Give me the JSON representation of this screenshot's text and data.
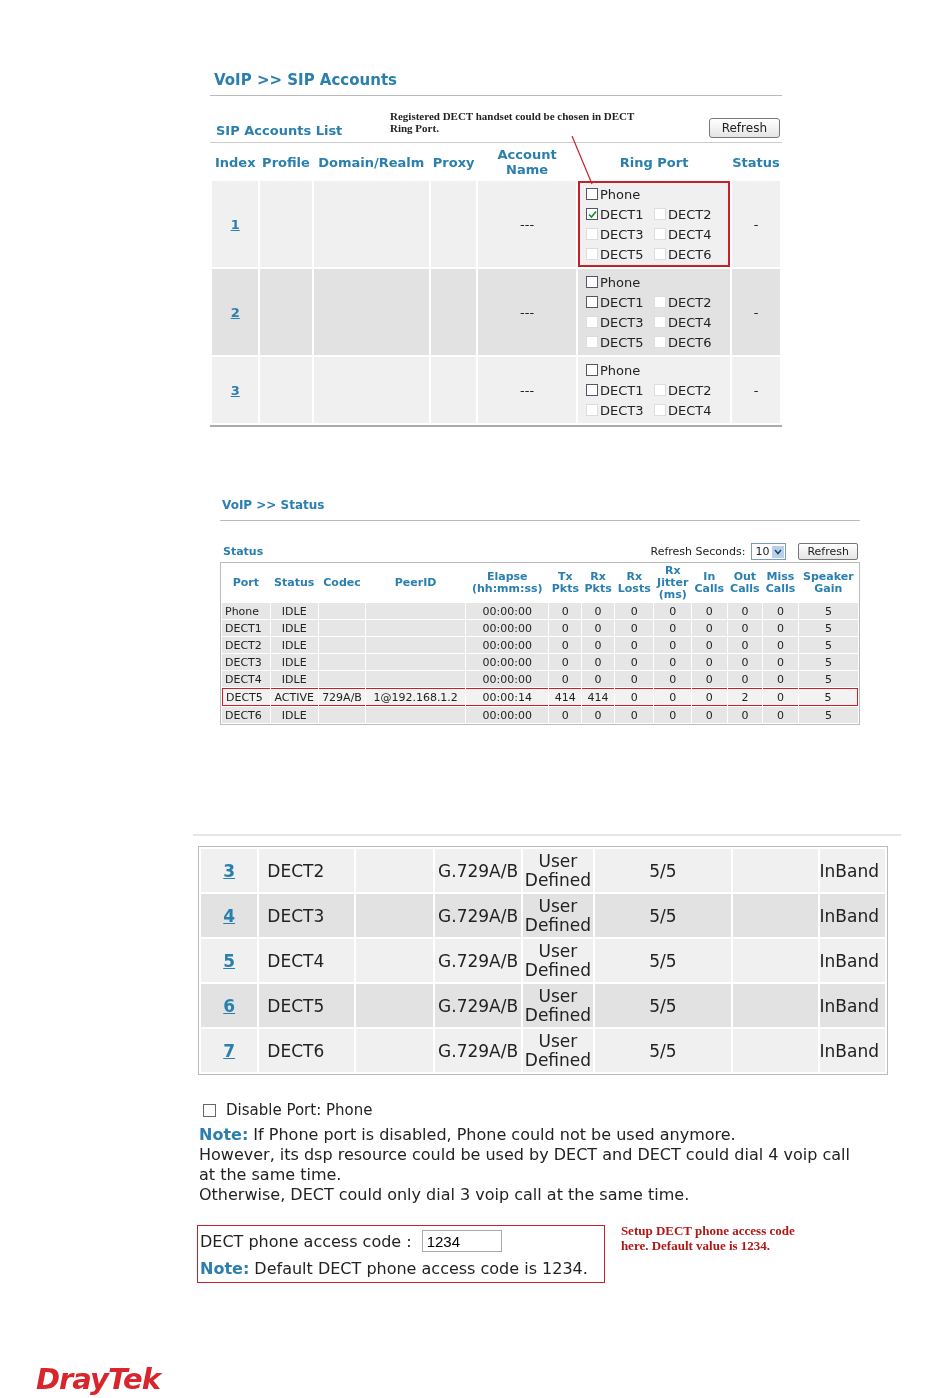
{
  "sip_accounts": {
    "title": "VoIP >> SIP Accounts",
    "list_title": "SIP Accounts List",
    "callout": "Registered DECT handset could be chosen in DECT Ring Port.",
    "refresh_button": "Refresh",
    "columns": [
      "Index",
      "Profile",
      "Domain/Realm",
      "Proxy",
      "Account\nName",
      "Ring Port",
      "Status"
    ],
    "rows": [
      {
        "index": "1",
        "account_name": "---",
        "status": "-",
        "highlighted": true,
        "ring_ports": [
          {
            "label": "Phone",
            "checked": false,
            "disabled": false
          },
          {
            "label": "DECT1",
            "checked": true,
            "disabled": false
          },
          {
            "label": "DECT2",
            "checked": false,
            "disabled": true
          },
          {
            "label": "DECT3",
            "checked": false,
            "disabled": true
          },
          {
            "label": "DECT4",
            "checked": false,
            "disabled": true
          },
          {
            "label": "DECT5",
            "checked": false,
            "disabled": true
          },
          {
            "label": "DECT6",
            "checked": false,
            "disabled": true
          }
        ]
      },
      {
        "index": "2",
        "account_name": "---",
        "status": "-",
        "highlighted": false,
        "ring_ports": [
          {
            "label": "Phone",
            "checked": false,
            "disabled": false
          },
          {
            "label": "DECT1",
            "checked": false,
            "disabled": false
          },
          {
            "label": "DECT2",
            "checked": false,
            "disabled": true
          },
          {
            "label": "DECT3",
            "checked": false,
            "disabled": true
          },
          {
            "label": "DECT4",
            "checked": false,
            "disabled": true
          },
          {
            "label": "DECT5",
            "checked": false,
            "disabled": true
          },
          {
            "label": "DECT6",
            "checked": false,
            "disabled": true
          }
        ]
      },
      {
        "index": "3",
        "account_name": "---",
        "status": "-",
        "highlighted": false,
        "ring_ports": [
          {
            "label": "Phone",
            "checked": false,
            "disabled": false
          },
          {
            "label": "DECT1",
            "checked": false,
            "disabled": false
          },
          {
            "label": "DECT2",
            "checked": false,
            "disabled": true
          },
          {
            "label": "DECT3",
            "checked": false,
            "disabled": true
          },
          {
            "label": "DECT4",
            "checked": false,
            "disabled": true
          }
        ]
      }
    ]
  },
  "voip_status": {
    "title": "VoIP >> Status",
    "section_title": "Status",
    "refresh_label": "Refresh Seconds:",
    "refresh_seconds": "10",
    "refresh_button": "Refresh",
    "columns": [
      "Port",
      "Status",
      "Codec",
      "PeerID",
      "Elapse\n(hh:mm:ss)",
      "Tx\nPkts",
      "Rx\nPkts",
      "Rx\nLosts",
      "Rx\nJitter\n(ms)",
      "In\nCalls",
      "Out\nCalls",
      "Miss\nCalls",
      "Speaker\nGain"
    ],
    "rows": [
      {
        "highlighted": false,
        "cells": [
          "Phone",
          "IDLE",
          "",
          "",
          "00:00:00",
          "0",
          "0",
          "0",
          "0",
          "0",
          "0",
          "0",
          "5"
        ]
      },
      {
        "highlighted": false,
        "cells": [
          "DECT1",
          "IDLE",
          "",
          "",
          "00:00:00",
          "0",
          "0",
          "0",
          "0",
          "0",
          "0",
          "0",
          "5"
        ]
      },
      {
        "highlighted": false,
        "cells": [
          "DECT2",
          "IDLE",
          "",
          "",
          "00:00:00",
          "0",
          "0",
          "0",
          "0",
          "0",
          "0",
          "0",
          "5"
        ]
      },
      {
        "highlighted": false,
        "cells": [
          "DECT3",
          "IDLE",
          "",
          "",
          "00:00:00",
          "0",
          "0",
          "0",
          "0",
          "0",
          "0",
          "0",
          "5"
        ]
      },
      {
        "highlighted": false,
        "cells": [
          "DECT4",
          "IDLE",
          "",
          "",
          "00:00:00",
          "0",
          "0",
          "0",
          "0",
          "0",
          "0",
          "0",
          "5"
        ]
      },
      {
        "highlighted": true,
        "cells": [
          "DECT5",
          "ACTIVE",
          "729A/B",
          "1@192.168.1.2",
          "00:00:14",
          "414",
          "414",
          "0",
          "0",
          "0",
          "2",
          "0",
          "5"
        ]
      },
      {
        "highlighted": false,
        "cells": [
          "DECT6",
          "IDLE",
          "",
          "",
          "00:00:00",
          "0",
          "0",
          "0",
          "0",
          "0",
          "0",
          "0",
          "5"
        ]
      }
    ]
  },
  "port_settings": {
    "rows": [
      {
        "index": "3",
        "port": "DECT2",
        "codec": "G.729A/B",
        "tone": "User Defined",
        "gain": "5/5",
        "dtmf": "InBand"
      },
      {
        "index": "4",
        "port": "DECT3",
        "codec": "G.729A/B",
        "tone": "User Defined",
        "gain": "5/5",
        "dtmf": "InBand"
      },
      {
        "index": "5",
        "port": "DECT4",
        "codec": "G.729A/B",
        "tone": "User Defined",
        "gain": "5/5",
        "dtmf": "InBand"
      },
      {
        "index": "6",
        "port": "DECT5",
        "codec": "G.729A/B",
        "tone": "User Defined",
        "gain": "5/5",
        "dtmf": "InBand"
      },
      {
        "index": "7",
        "port": "DECT6",
        "codec": "G.729A/B",
        "tone": "User Defined",
        "gain": "5/5",
        "dtmf": "InBand"
      }
    ],
    "disable_port": {
      "label": "Disable Port: Phone",
      "checked": false
    },
    "notes": [
      "**Note:** If Phone port is disabled, Phone could not be used anymore.",
      "However, its dsp resource could be used by DECT and DECT could dial 4 voip call at the same time.",
      "Otherwise, DECT could only dial 3 voip call at the same time."
    ],
    "access_code": {
      "label": "DECT phone access code :",
      "value": "1234",
      "note": "**Note:** Default DECT phone access code is 1234.",
      "callout": "Setup DECT phone access code here. Default value is 1234."
    }
  },
  "logo": "DrayTek"
}
